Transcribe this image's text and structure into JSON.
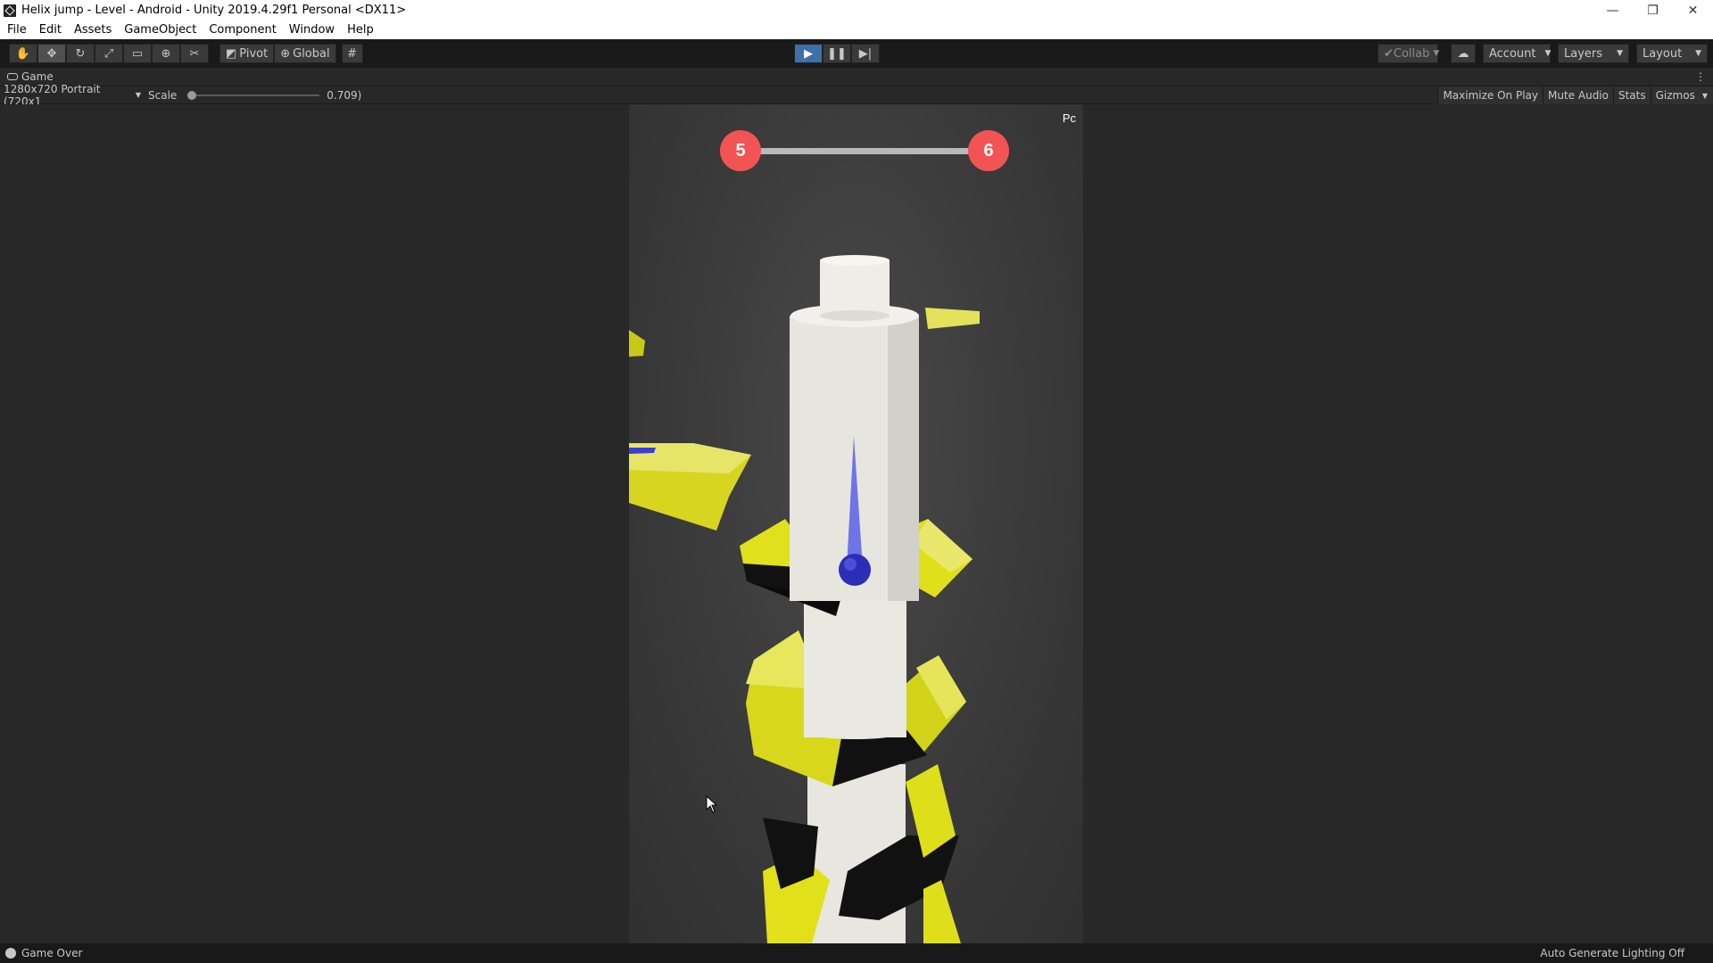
{
  "window": {
    "title": "Helix jump - Level - Android - Unity 2019.4.29f1 Personal <DX11>",
    "controls": {
      "minimize": "—",
      "restore": "❐",
      "close": "✕"
    }
  },
  "menu": [
    "File",
    "Edit",
    "Assets",
    "GameObject",
    "Component",
    "Window",
    "Help"
  ],
  "toolbar": {
    "transform_tools": [
      "hand-icon",
      "move-icon",
      "rotate-icon",
      "scale-icon",
      "rect-icon",
      "transform-icon",
      "custom-tool-icon"
    ],
    "pivot_label": "Pivot",
    "global_label": "Global",
    "snap_icon": "grid-snap-icon",
    "play_state": "playing",
    "collab_label": "Collab",
    "account_label": "Account",
    "layers_label": "Layers",
    "layout_label": "Layout"
  },
  "tab": {
    "label": "Game"
  },
  "game_bar": {
    "resolution": "1280x720 Portrait (720x1",
    "scale_label": "Scale",
    "scale_value": "0.709)",
    "scale_fraction": 0.0,
    "toggles": [
      "Maximize On Play",
      "Mute Audio",
      "Stats",
      "Gizmos"
    ]
  },
  "game": {
    "current_level": "5",
    "next_level": "6",
    "level_progress": 0.0,
    "corner_label": "Pc",
    "colors": {
      "badge": "#f25454",
      "platform": "#e3e21c",
      "danger": "#111111",
      "ball": "#2b2fb8",
      "pole": "#e8e8e2"
    }
  },
  "status": {
    "message": "Game Over",
    "right": "Auto Generate Lighting Off"
  }
}
